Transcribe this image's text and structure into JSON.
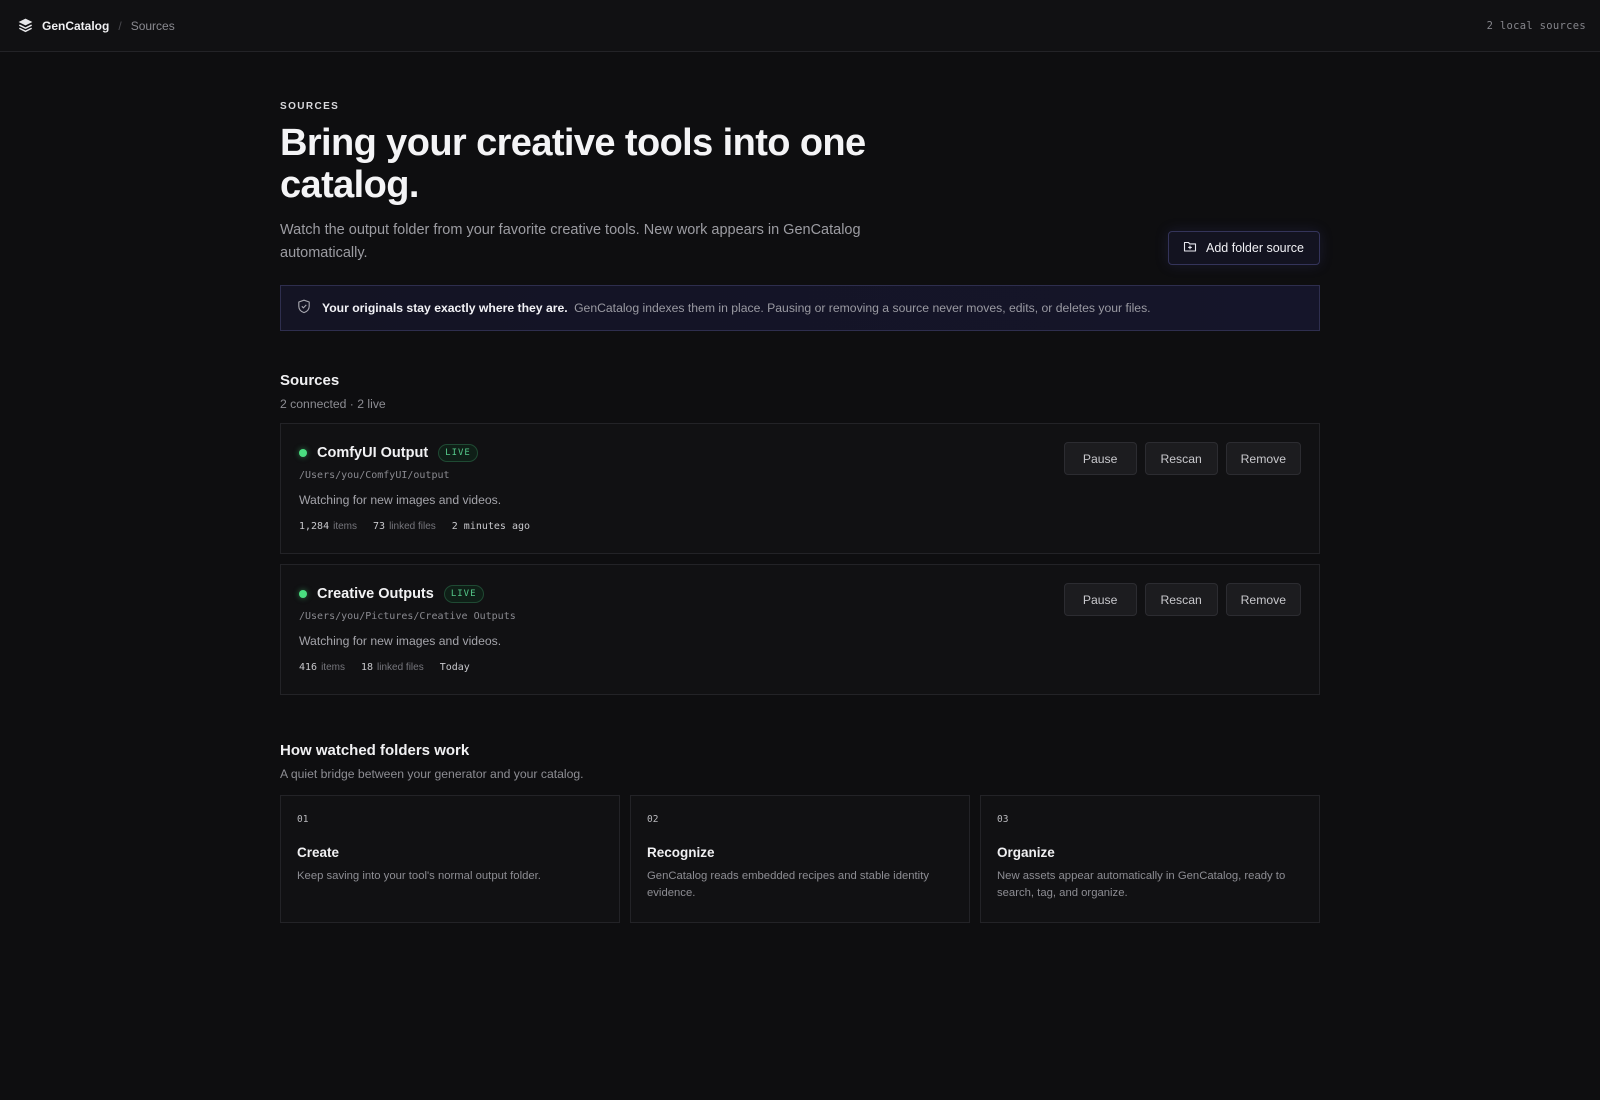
{
  "topbar": {
    "brand": "GenCatalog",
    "separator": "/",
    "crumb": "Sources",
    "local_sources": "2 local sources"
  },
  "hero": {
    "eyebrow": "SOURCES",
    "title": "Bring your creative tools into one catalog.",
    "lede": "Watch the output folder from your favorite creative tools. New work appears in GenCatalog automatically.",
    "add_button": "Add folder source"
  },
  "notice": {
    "strong": "Your originals stay exactly where they are.",
    "text": "GenCatalog indexes them in place. Pausing or removing a source never moves, edits, or deletes your files."
  },
  "sources": {
    "title": "Sources",
    "subtitle": "2 connected · 2 live",
    "items": [
      {
        "name": "ComfyUI Output",
        "badge": "LIVE",
        "path": "/Users/you/ComfyUI/output",
        "description": "Watching for new images and videos.",
        "items_count": "1,284",
        "items_label": "items",
        "linked_count": "73",
        "linked_label": "linked files",
        "updated": "2 minutes ago",
        "actions": [
          "Pause",
          "Rescan",
          "Remove"
        ],
        "status_color": "#4ade80"
      },
      {
        "name": "Creative Outputs",
        "badge": "LIVE",
        "path": "/Users/you/Pictures/Creative Outputs",
        "description": "Watching for new images and videos.",
        "items_count": "416",
        "items_label": "items",
        "linked_count": "18",
        "linked_label": "linked files",
        "updated": "Today",
        "actions": [
          "Pause",
          "Rescan",
          "Remove"
        ],
        "status_color": "#4ade80"
      }
    ]
  },
  "how": {
    "title": "How watched folders work",
    "subtitle": "A quiet bridge between your generator and your catalog.",
    "steps": [
      {
        "num": "01",
        "title": "Create",
        "text": "Keep saving into your tool's normal output folder."
      },
      {
        "num": "02",
        "title": "Recognize",
        "text": "GenCatalog reads embedded recipes and stable identity evidence."
      },
      {
        "num": "03",
        "title": "Organize",
        "text": "New assets appear automatically in GenCatalog, ready to search, tag, and organize."
      }
    ]
  },
  "icons": {
    "logo": "stacked-layers-icon",
    "add": "folder-plus-icon",
    "notice": "shield-check-icon",
    "status": "status-dot-icon"
  }
}
